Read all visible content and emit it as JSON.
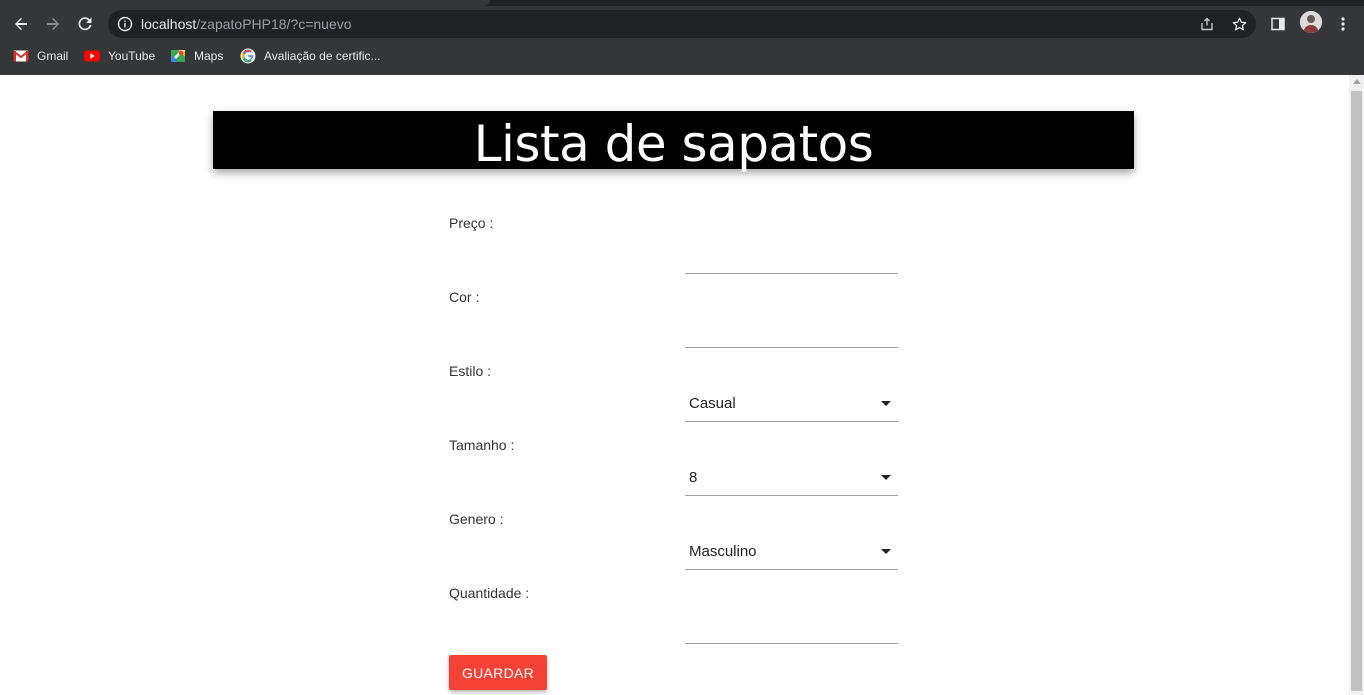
{
  "browser": {
    "url_host": "localhost",
    "url_path": "/zapatoPHP18/?c=nuevo",
    "bookmarks": [
      {
        "label": "Gmail",
        "icon": "gmail-icon"
      },
      {
        "label": "YouTube",
        "icon": "youtube-icon"
      },
      {
        "label": "Maps",
        "icon": "maps-icon"
      },
      {
        "label": "Avaliação de certific...",
        "icon": "google-icon"
      }
    ],
    "icons": [
      "back-arrow-icon",
      "forward-arrow-icon",
      "reload-icon",
      "info-icon",
      "share-icon",
      "star-icon",
      "side-panel-icon",
      "avatar",
      "kebab-menu-icon"
    ]
  },
  "page": {
    "title": "Lista de sapatos",
    "form": {
      "fields": [
        {
          "label": "Preço :",
          "type": "text",
          "value": ""
        },
        {
          "label": "Cor :",
          "type": "text",
          "value": ""
        },
        {
          "label": "Estilo :",
          "type": "select",
          "value": "Casual"
        },
        {
          "label": "Tamanho :",
          "type": "select",
          "value": "8"
        },
        {
          "label": "Genero :",
          "type": "select",
          "value": "Masculino"
        },
        {
          "label": "Quantidade :",
          "type": "text",
          "value": ""
        }
      ],
      "submit_label": "GUARDAR"
    }
  },
  "colors": {
    "chrome_bg": "#35363a",
    "omnibox_bg": "#202124",
    "header_bg": "#000000",
    "button_bg": "#f44336"
  }
}
